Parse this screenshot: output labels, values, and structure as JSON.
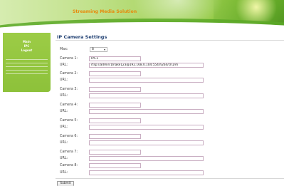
{
  "header": {
    "title": "Streaming Media Solution"
  },
  "sidebar": {
    "items": [
      {
        "label": "Main"
      },
      {
        "label": "IPC"
      },
      {
        "label": "Logout"
      }
    ]
  },
  "main": {
    "title": "IP Camera Settings",
    "max": {
      "label": "Max:",
      "value": "8",
      "chevron": "▾"
    },
    "cameras": [
      {
        "label": "Camera 1:",
        "name": "IPC1",
        "url_label": "URL:",
        "url": "rtsp://admin:Dnake123@192.168.0.104:554/h264/ch1/m"
      },
      {
        "label": "Camera 2:",
        "name": "",
        "url_label": "URL:",
        "url": ""
      },
      {
        "label": "Camera 3:",
        "name": "",
        "url_label": "URL:",
        "url": ""
      },
      {
        "label": "Camera 4:",
        "name": "",
        "url_label": "URL:",
        "url": ""
      },
      {
        "label": "Camera 5:",
        "name": "",
        "url_label": "URL:",
        "url": ""
      },
      {
        "label": "Camera 6:",
        "name": "",
        "url_label": "URL:",
        "url": ""
      },
      {
        "label": "Camera 7:",
        "name": "",
        "url_label": "URL:",
        "url": ""
      },
      {
        "label": "Camera 8:",
        "name": "",
        "url_label": "URL:",
        "url": ""
      }
    ],
    "submit_label": "Submit"
  }
}
